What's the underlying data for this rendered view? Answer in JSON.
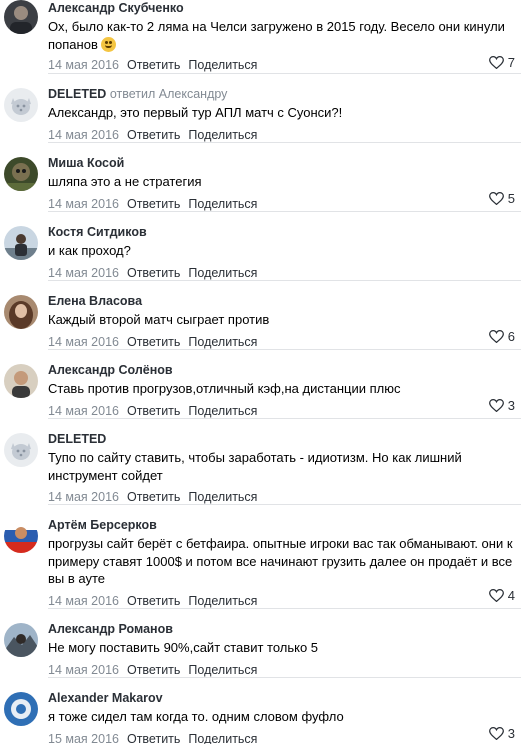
{
  "actions": {
    "reply": "Ответить",
    "share": "Поделиться"
  },
  "comments": [
    {
      "author": "Александр Скубченко",
      "text": "Ох, было как-то 2 ляма на Челси загружено в 2015 году. Весело они кинули попанов",
      "emoji": "laughing-emoji",
      "date": "14 мая 2016",
      "likes": "7",
      "avatar": "photo-dark"
    },
    {
      "author": "DELETED",
      "reply_note": "ответил",
      "reply_to": "Александру",
      "text": "Александр, это первый тур АПЛ матч с Суонси?!",
      "date": "14 мая 2016",
      "likes": "",
      "avatar": "deleted-dog"
    },
    {
      "author": "Миша Косой",
      "text": "шляпа это а не стратегия",
      "date": "14 мая 2016",
      "likes": "5",
      "avatar": "photo-green"
    },
    {
      "author": "Костя Ситдиков",
      "text": "и как проход?",
      "date": "14 мая 2016",
      "likes": "",
      "avatar": "photo-sky"
    },
    {
      "author": "Елена Власова",
      "text": "Каждый второй матч сыграет против",
      "date": "14 мая 2016",
      "likes": "6",
      "avatar": "photo-warm"
    },
    {
      "author": "Александр Солёнов",
      "text": "Ставь против прогрузов,отличный кэф,на дистанции плюс",
      "date": "14 мая 2016",
      "likes": "3",
      "avatar": "photo-beige"
    },
    {
      "author": "DELETED",
      "text": "Тупо по сайту ставить, чтобы заработать - идиотизм. Но как лишний инструмент сойдет",
      "date": "14 мая 2016",
      "likes": "",
      "avatar": "deleted-dog"
    },
    {
      "author": "Артём Берсерков",
      "text": "прогрузы сайт берёт с бетфаира. опытные игроки вас так обманывают. они к примеру ставят 1000$ и потом все начинают грузить далее он продаёт и все вы в ауте",
      "date": "14 мая 2016",
      "likes": "4",
      "avatar": "photo-flag"
    },
    {
      "author": "Александр Романов",
      "text": "Не могу поставить 90%,сайт ставит только 5",
      "date": "14 мая 2016",
      "likes": "",
      "avatar": "photo-mountain"
    },
    {
      "author": "Alexander Makarov",
      "text": "я тоже сидел там когда то. одним словом фуфло",
      "date": "15 мая 2016",
      "likes": "3",
      "avatar": "photo-blue"
    }
  ],
  "colors": {
    "link": "#2a2f36",
    "muted": "#828a93",
    "separator": "#e1e3e6"
  }
}
